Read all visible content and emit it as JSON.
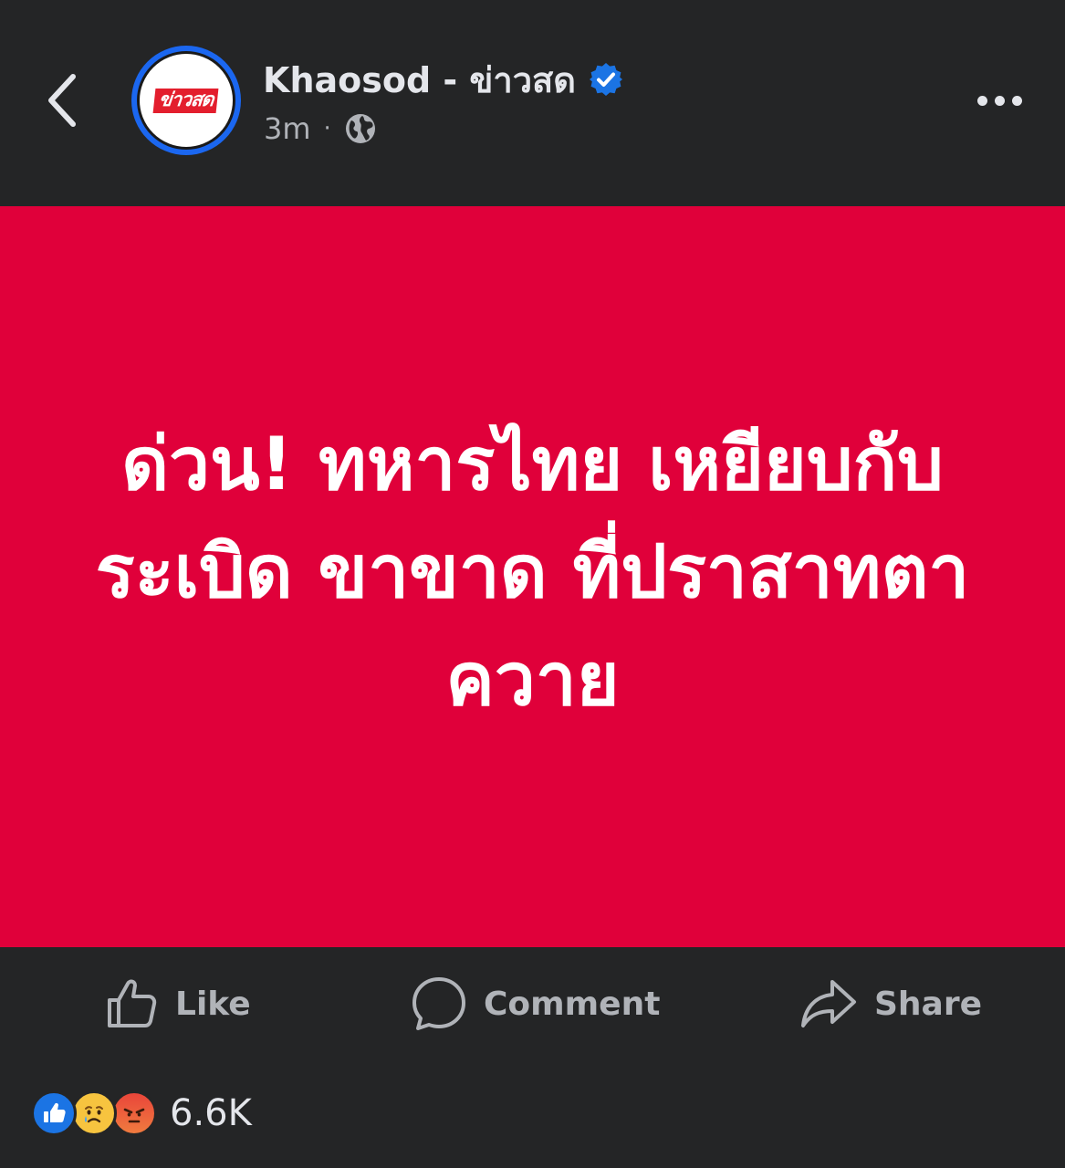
{
  "header": {
    "page_name": "Khaosod - ข่าวสด",
    "avatar_text": "ข่าวสด",
    "timestamp": "3m",
    "separator": "·",
    "privacy_icon": "globe-icon",
    "verified_icon": "verified-badge-icon",
    "back_icon": "chevron-left-icon",
    "more_icon": "more-horizontal-icon"
  },
  "post": {
    "headline": "ด่วน! ทหารไทย เหยียบกับระเบิด ขาขาด ที่ปราสาทตาควาย",
    "background_color": "#e0003a",
    "text_color": "#ffffff"
  },
  "actions": {
    "like_label": "Like",
    "comment_label": "Comment",
    "share_label": "Share"
  },
  "reactions": {
    "types": [
      "like",
      "sad",
      "angry"
    ],
    "count": "6.6K"
  },
  "colors": {
    "background": "#242526",
    "primary_text": "#e4e6eb",
    "secondary_text": "#b0b3b8",
    "accent_blue": "#1b74e4"
  }
}
